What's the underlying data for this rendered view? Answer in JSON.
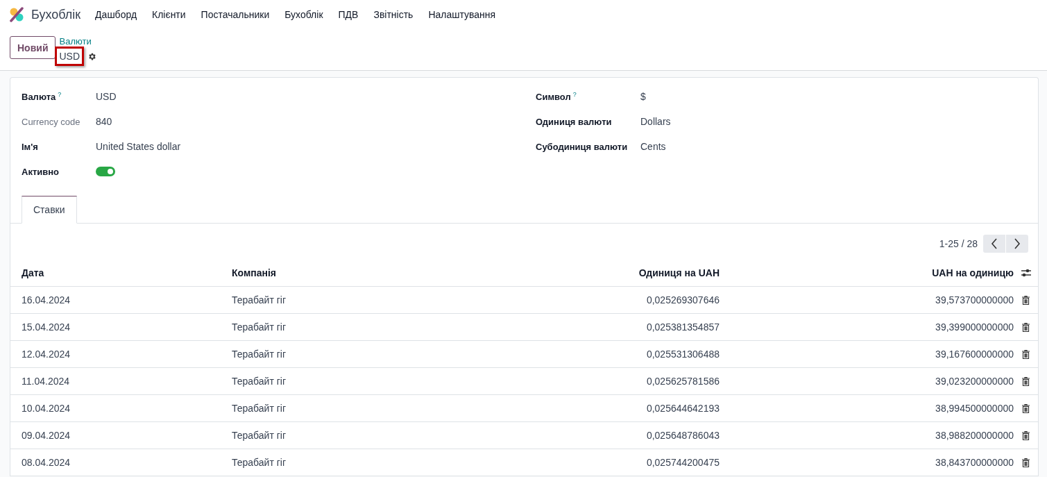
{
  "app_name": "Бухоблік",
  "menu": [
    "Дашборд",
    "Клієнти",
    "Постачальники",
    "Бухоблік",
    "ПДВ",
    "Звітність",
    "Налаштування"
  ],
  "new_button": "Новий",
  "breadcrumb": {
    "parent": "Валюти",
    "current": "USD",
    "highlighted": true
  },
  "fields_left": [
    {
      "kind": "text",
      "label": "Валюта",
      "help": "?",
      "muted": false,
      "value": "USD"
    },
    {
      "kind": "text",
      "label": "Currency code",
      "muted": true,
      "value": "840"
    },
    {
      "kind": "text",
      "label": "Ім'я",
      "muted": false,
      "value": "United States dollar"
    },
    {
      "kind": "toggle",
      "label": "Активно",
      "muted": false,
      "on": true
    }
  ],
  "fields_right": [
    {
      "kind": "text",
      "label": "Символ",
      "help": "?",
      "muted": false,
      "value": "$"
    },
    {
      "kind": "text",
      "label": "Одиниця валюти",
      "muted": false,
      "value": "Dollars"
    },
    {
      "kind": "text",
      "label": "Субодиниця валюти",
      "muted": false,
      "value": "Cents"
    }
  ],
  "tabs": [
    {
      "label": "Ставки",
      "selected": true
    }
  ],
  "pager": "1-25 / 28",
  "table": {
    "columns": [
      "Дата",
      "Компанія",
      "Одиниця на UAH",
      "UAH на одиницю"
    ],
    "rows": [
      {
        "date": "16.04.2024",
        "company": "Терабайт гіг",
        "unit_per_uah": "0,025269307646",
        "uah_per_unit": "39,573700000000"
      },
      {
        "date": "15.04.2024",
        "company": "Терабайт гіг",
        "unit_per_uah": "0,025381354857",
        "uah_per_unit": "39,399000000000"
      },
      {
        "date": "12.04.2024",
        "company": "Терабайт гіг",
        "unit_per_uah": "0,025531306488",
        "uah_per_unit": "39,167600000000"
      },
      {
        "date": "11.04.2024",
        "company": "Терабайт гіг",
        "unit_per_uah": "0,025625781586",
        "uah_per_unit": "39,023200000000"
      },
      {
        "date": "10.04.2024",
        "company": "Терабайт гіг",
        "unit_per_uah": "0,025644642193",
        "uah_per_unit": "38,994500000000"
      },
      {
        "date": "09.04.2024",
        "company": "Терабайт гіг",
        "unit_per_uah": "0,025648786043",
        "uah_per_unit": "38,988200000000"
      },
      {
        "date": "08.04.2024",
        "company": "Терабайт гіг",
        "unit_per_uah": "0,025744200475",
        "uah_per_unit": "38,843700000000"
      }
    ]
  }
}
